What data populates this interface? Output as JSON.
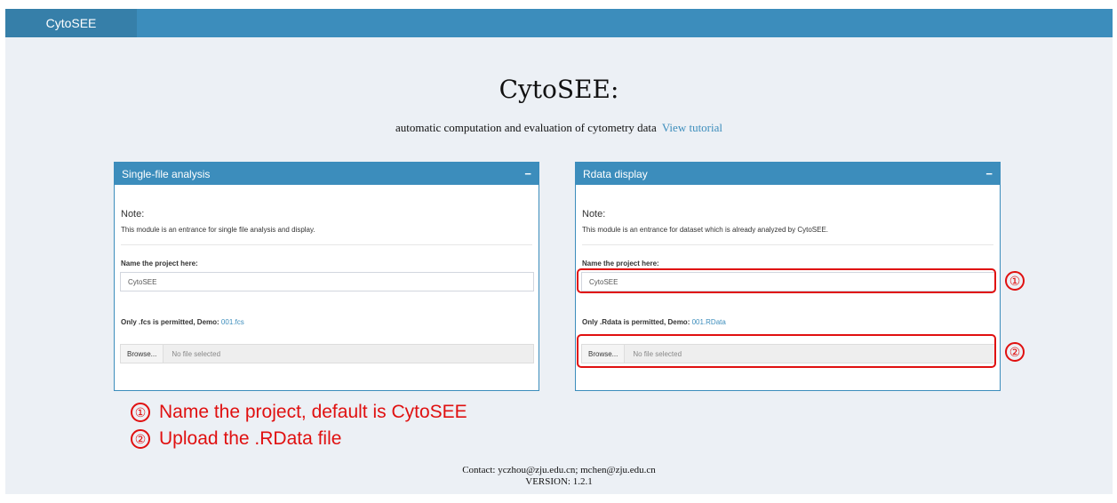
{
  "header": {
    "brand": "CytoSEE"
  },
  "hero": {
    "title": "CytoSEE:",
    "subtitle": "automatic computation and evaluation of cytometry data",
    "tutorial_link": "View tutorial"
  },
  "left_panel": {
    "title": "Single-file analysis",
    "collapse": "−",
    "note_heading": "Note:",
    "note_text": "This module is an entrance for single file analysis and display.",
    "name_label": "Name the project here:",
    "name_value": "CytoSEE",
    "upload_label": "Only .fcs is permitted, Demo: ",
    "demo_link": "001.fcs",
    "browse_label": "Browse...",
    "file_status": "No file selected"
  },
  "right_panel": {
    "title": "Rdata display",
    "collapse": "−",
    "note_heading": "Note:",
    "note_text": "This module is an entrance for dataset which is already analyzed by CytoSEE.",
    "name_label": "Name the project here:",
    "name_value": "CytoSEE",
    "upload_label": "Only .Rdata is permitted, Demo: ",
    "demo_link": "001.RData",
    "browse_label": "Browse...",
    "file_status": "No file selected"
  },
  "annotations": {
    "marker1": "①",
    "marker2": "②",
    "text1": "Name the project, default is CytoSEE",
    "text2": "Upload the .RData file",
    "color": "#e01010"
  },
  "footer": {
    "contact": "Contact: yczhou@zju.edu.cn; mchen@zju.edu.cn",
    "version": "VERSION: 1.2.1"
  },
  "colors": {
    "primary": "#3c8dbc",
    "background": "#ecf0f5"
  }
}
